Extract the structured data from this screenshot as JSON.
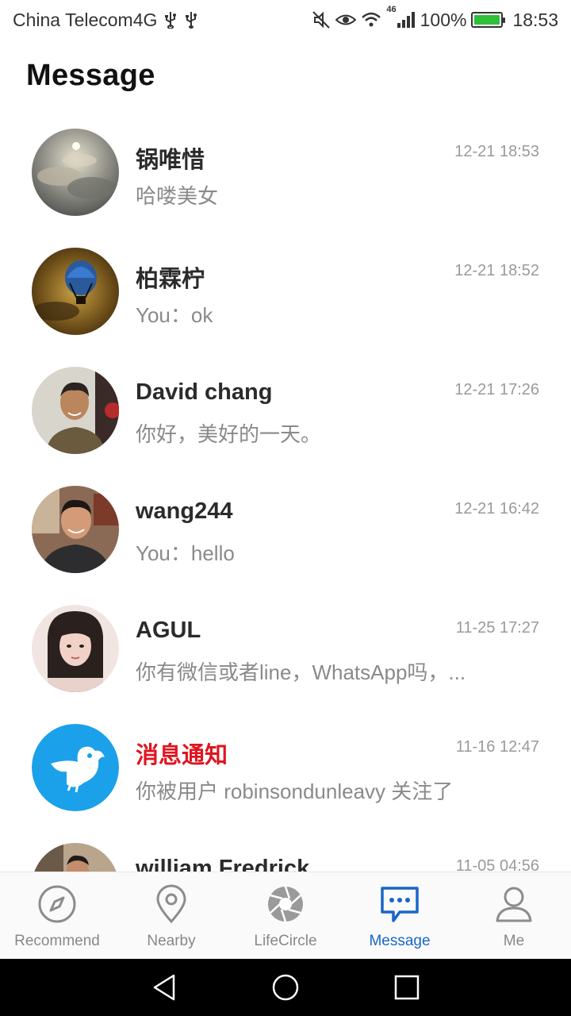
{
  "status_bar": {
    "carrier": "China Telecom4G",
    "usb_icons": [
      "usb-icon",
      "usb-icon"
    ],
    "network": "46",
    "battery": "100%",
    "time": "18:53",
    "battery_color": "#2fbf3b"
  },
  "header": {
    "title": "Message"
  },
  "conversations": [
    {
      "name": "锅唯惜",
      "preview": "哈喽美女",
      "time": "12-21 18:53",
      "avatar": "sky-clouds"
    },
    {
      "name": "柏霖柠",
      "preview": "You：ok",
      "time": "12-21 18:52",
      "avatar": "hot-air-balloon"
    },
    {
      "name": "David chang",
      "preview": "你好，美好的一天。",
      "time": "12-21 17:26",
      "avatar": "man-portrait"
    },
    {
      "name": "wang244",
      "preview": "You：hello",
      "time": "12-21 16:42",
      "avatar": "man-portrait"
    },
    {
      "name": "AGUL",
      "preview": "你有微信或者line，WhatsApp吗，...",
      "time": "11-25 17:27",
      "avatar": "woman-portrait"
    },
    {
      "name": "消息通知",
      "preview": "你被用户 robinsondunleavy 关注了",
      "time": "11-16 12:47",
      "avatar": "bird-logo"
    },
    {
      "name": "william Fredrick",
      "preview": "",
      "time": "11-05 04:56",
      "avatar": "man-portrait"
    }
  ],
  "bottom_nav": [
    {
      "label": "Recommend",
      "icon": "compass-icon",
      "active": false
    },
    {
      "label": "Nearby",
      "icon": "location-pin-icon",
      "active": false
    },
    {
      "label": "LifeCircle",
      "icon": "aperture-icon",
      "active": false
    },
    {
      "label": "Message",
      "icon": "chat-bubble-icon",
      "active": true
    },
    {
      "label": "Me",
      "icon": "person-icon",
      "active": false
    }
  ],
  "colors": {
    "accent": "#1a66c7",
    "notice_red": "#e0141f",
    "bird_blue": "#1aa1ea"
  }
}
